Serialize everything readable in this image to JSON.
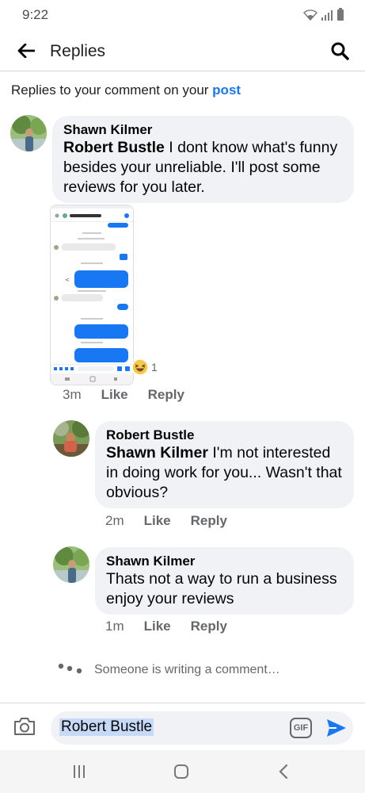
{
  "status_bar": {
    "time": "9:22",
    "icons": [
      "wifi-icon",
      "signal-icon",
      "battery-icon"
    ]
  },
  "header": {
    "title": "Replies",
    "back_icon": "arrow-left-icon",
    "search_icon": "search-icon"
  },
  "context": {
    "prefix": "Replies to your comment on your ",
    "link": "post"
  },
  "comments": [
    {
      "author": "Shawn Kilmer",
      "mention": "Robert Bustle",
      "text": " I dont know what's funny besides your unreliable. I'll post some reviews for you later.",
      "time": "3m",
      "like": "Like",
      "reply": "Reply",
      "attachment": {
        "header": "Shawn - HVAC Helper",
        "messages": [
          "911 Here",
          "Ok. Be there in about 3 minutes",
          "Hey would you be able to come give me a quote on a ductless unit wiring and charging it",
          "Yes. One day next week",
          "Ok",
          "Would you have time to come by today and look at it",
          "Hey let me know when you would be able to look at it"
        ],
        "reaction_count": "1",
        "reaction_icon": "haha-emoji-icon"
      }
    },
    {
      "author": "Robert Bustle",
      "mention": "Shawn Kilmer",
      "text": " I'm not interested in doing work for you... Wasn't that obvious?",
      "time": "2m",
      "like": "Like",
      "reply": "Reply"
    },
    {
      "author": "Shawn Kilmer",
      "mention": "",
      "text": "Thats not a way to run a business enjoy your reviews",
      "time": "1m",
      "like": "Like",
      "reply": "Reply"
    }
  ],
  "typing": {
    "text": "Someone is writing a comment…"
  },
  "composer": {
    "value": "Robert Bustle",
    "gif_label": "GIF",
    "camera_icon": "camera-icon",
    "send_icon": "send-icon"
  },
  "navigation": {
    "icons": [
      "recent-apps-icon",
      "home-icon",
      "back-icon"
    ]
  },
  "colors": {
    "link": "#1877f2",
    "bubble": "#f0f2f5",
    "meta": "#65676b"
  }
}
